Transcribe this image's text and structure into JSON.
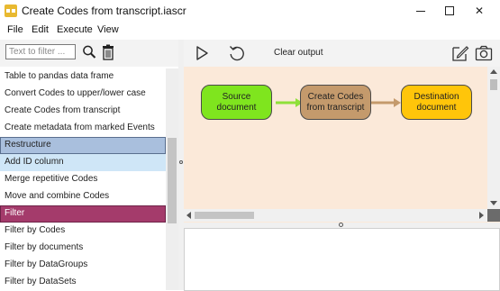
{
  "window": {
    "title": "Create Codes from transcript.iascr",
    "controls": {
      "minimize_icon": "minimize-icon",
      "maximize_icon": "maximize-icon",
      "close_icon": "close-icon",
      "close_glyph": "✕"
    }
  },
  "menu": [
    "File",
    "Edit",
    "Execute",
    "View"
  ],
  "left_panel": {
    "filter_placeholder": "Text to filter ...",
    "filter_value": "",
    "search_icon": "search-icon",
    "trash_icon": "trash-icon",
    "items": [
      {
        "label": "Table to pandas data frame",
        "state": "normal"
      },
      {
        "label": "Convert Codes to upper/lower case",
        "state": "normal"
      },
      {
        "label": "Create Codes from transcript",
        "state": "normal"
      },
      {
        "label": "Create metadata from marked Events",
        "state": "normal"
      },
      {
        "label": "Restructure",
        "state": "category"
      },
      {
        "label": "Add ID column",
        "state": "hover"
      },
      {
        "label": "Merge repetitive Codes",
        "state": "normal"
      },
      {
        "label": "Move and combine Codes",
        "state": "normal"
      },
      {
        "label": "Filter",
        "state": "category-active"
      },
      {
        "label": "Filter by Codes",
        "state": "normal"
      },
      {
        "label": "Filter by documents",
        "state": "normal"
      },
      {
        "label": "Filter by DataGroups",
        "state": "normal"
      },
      {
        "label": "Filter by DataSets",
        "state": "normal"
      }
    ]
  },
  "toolbar": {
    "run_icon": "play-icon",
    "reset_icon": "reset-icon",
    "clear_output_label": "Clear output",
    "edit_icon": "edit-icon",
    "screenshot_icon": "camera-icon"
  },
  "workflow": {
    "nodes": [
      {
        "id": "source",
        "label_line1": "Source",
        "label_line2": "document",
        "color": "#7fe51e"
      },
      {
        "id": "create",
        "label_line1": "Create Codes",
        "label_line2": "from transcript",
        "color": "#c49a6c"
      },
      {
        "id": "dest",
        "label_line1": "Destination",
        "label_line2": "document",
        "color": "#ffc50a"
      }
    ],
    "edges": [
      {
        "from": "source",
        "to": "create",
        "color": "#8fe03a"
      },
      {
        "from": "create",
        "to": "dest",
        "color": "#c49a6c"
      }
    ]
  },
  "colors": {
    "canvas_bg": "#fbe9d9",
    "selected_category": "#a9bfdd",
    "hover_item": "#cfe6f7",
    "active_category": "#a43b6b"
  }
}
